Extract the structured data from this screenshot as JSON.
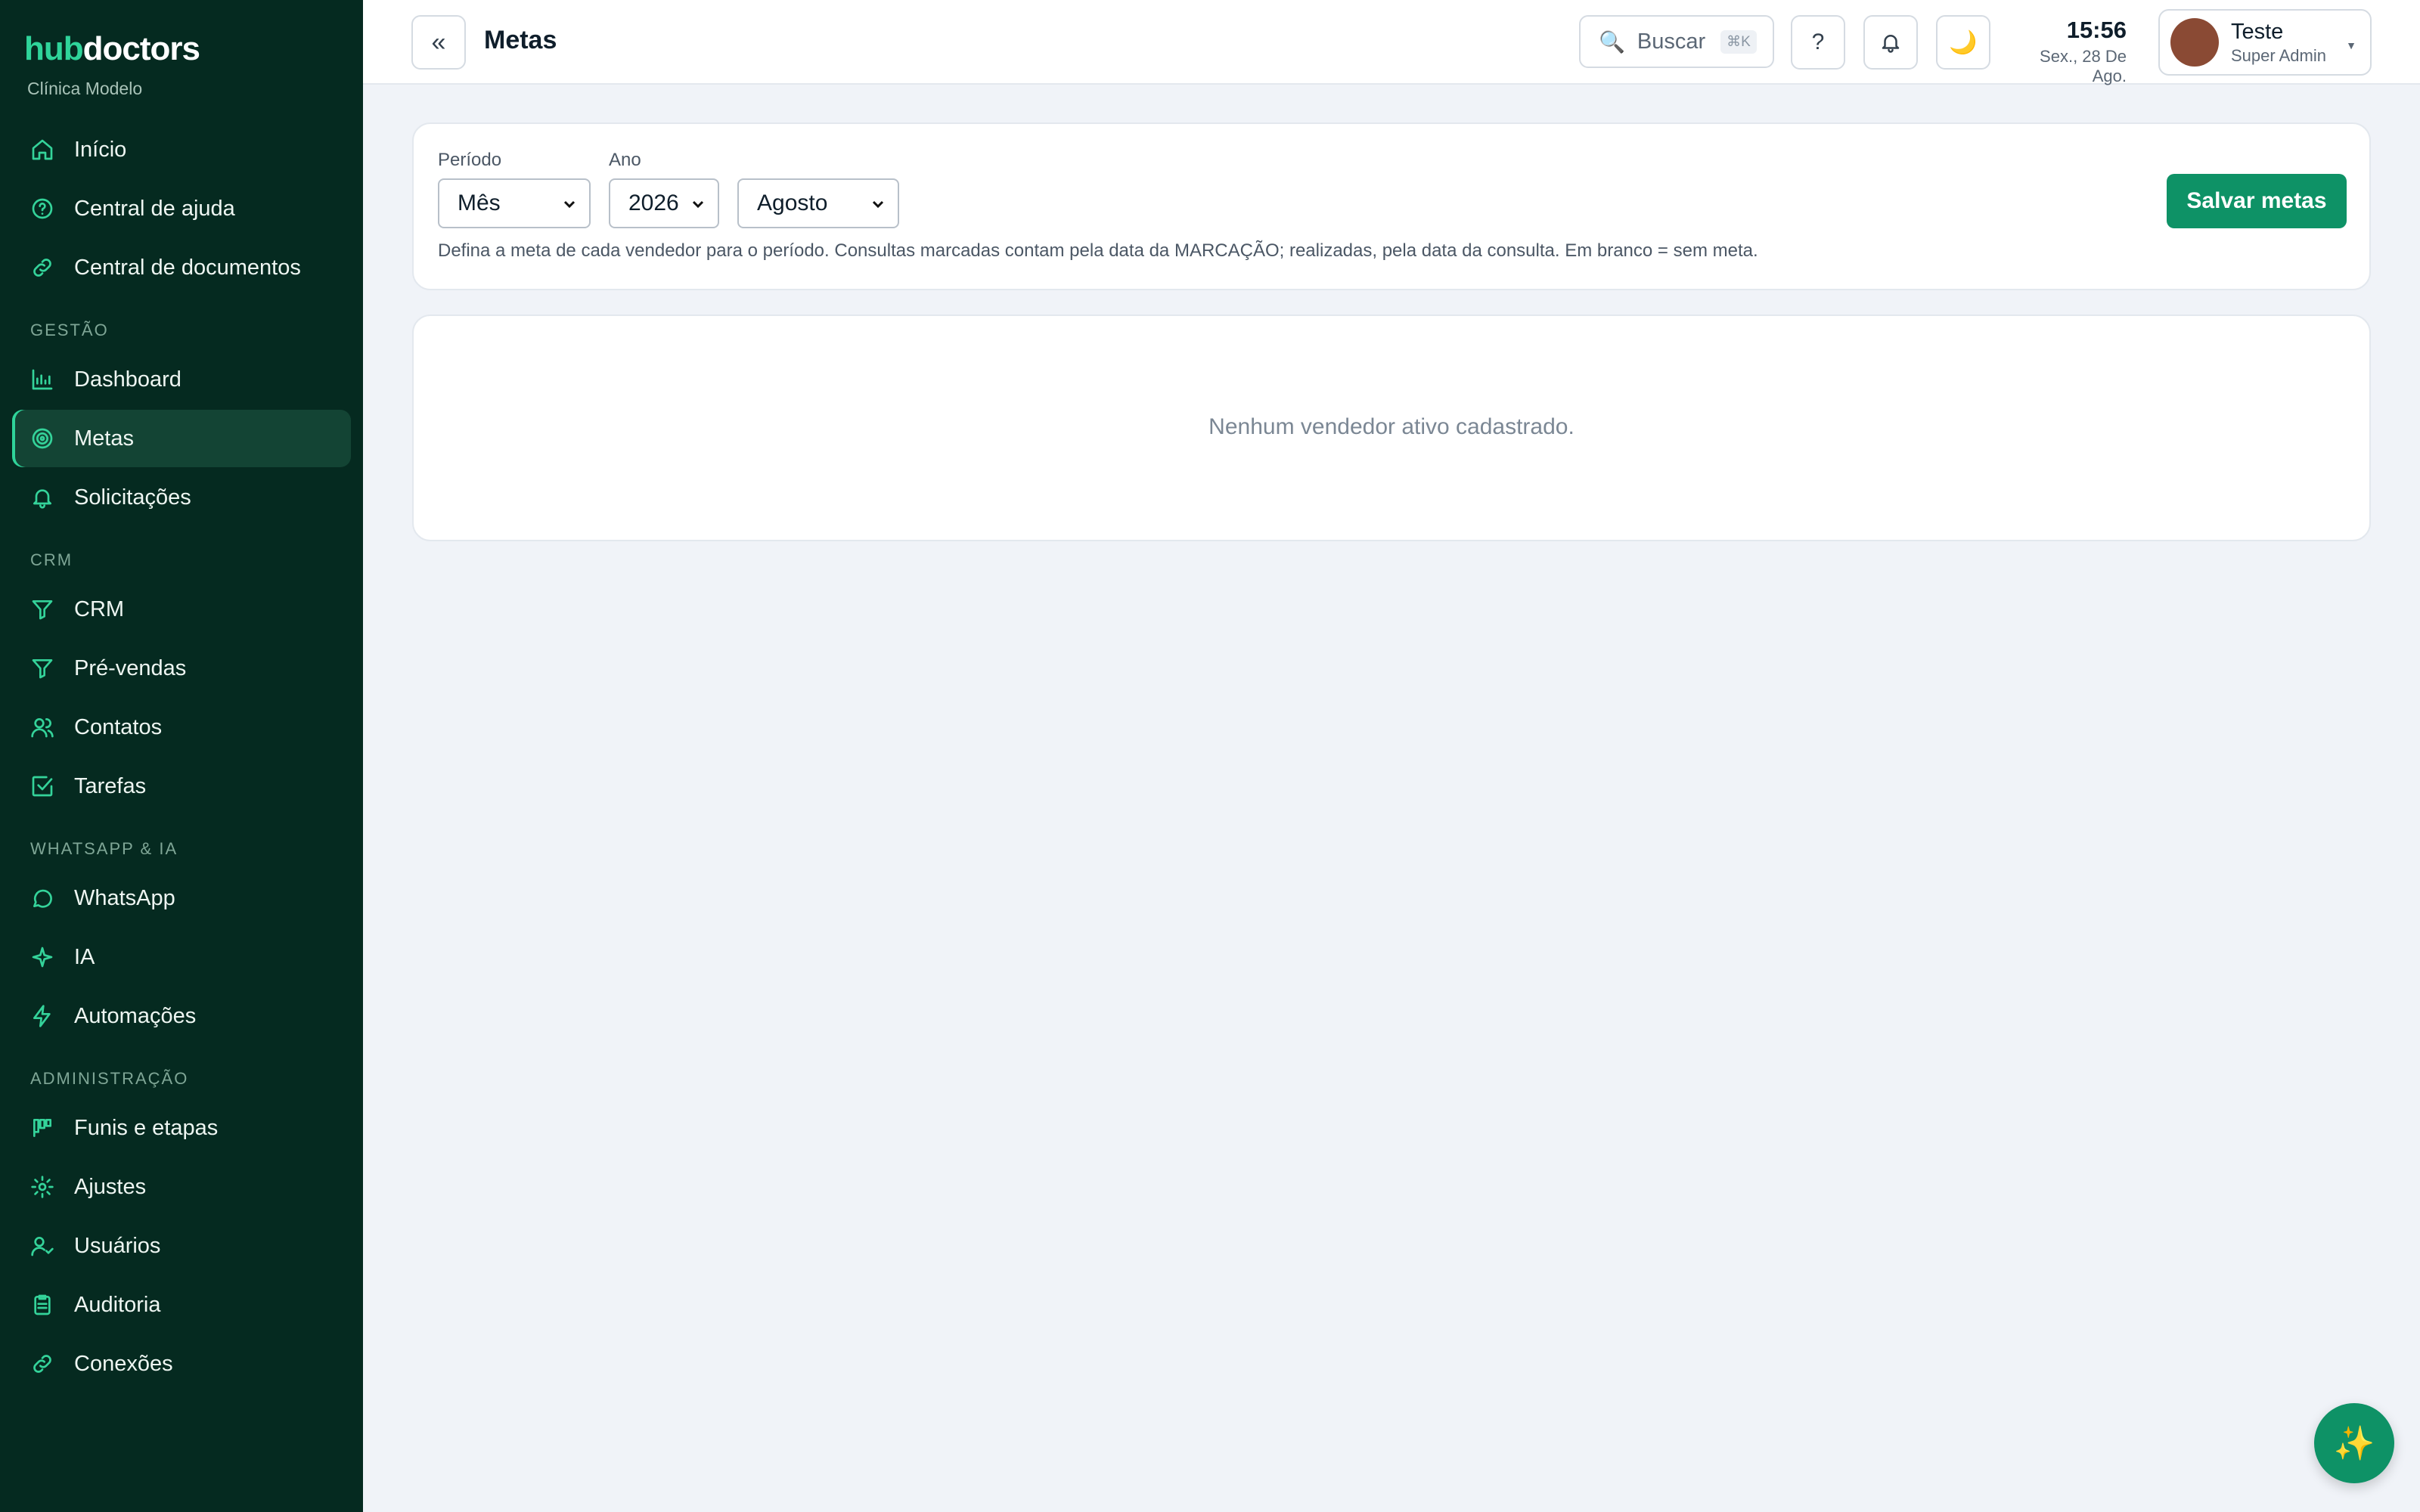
{
  "brand": {
    "part1": "hub",
    "part2": "doctors",
    "clinic": "Clínica Modelo"
  },
  "sidebar": {
    "items": [
      {
        "label": "Início",
        "icon": "home-icon"
      },
      {
        "label": "Central de ajuda",
        "icon": "help-circle-icon"
      },
      {
        "label": "Central de documentos",
        "icon": "link-icon"
      }
    ],
    "sections": [
      {
        "title": "GESTÃO",
        "items": [
          {
            "label": "Dashboard",
            "icon": "bar-chart-icon"
          },
          {
            "label": "Metas",
            "icon": "target-icon",
            "active": true
          },
          {
            "label": "Solicitações",
            "icon": "bell-icon"
          }
        ]
      },
      {
        "title": "CRM",
        "items": [
          {
            "label": "CRM",
            "icon": "funnel-icon"
          },
          {
            "label": "Pré-vendas",
            "icon": "funnel-icon"
          },
          {
            "label": "Contatos",
            "icon": "users-icon"
          },
          {
            "label": "Tarefas",
            "icon": "checkbox-icon"
          }
        ]
      },
      {
        "title": "WHATSAPP & IA",
        "items": [
          {
            "label": "WhatsApp",
            "icon": "chat-icon"
          },
          {
            "label": "IA",
            "icon": "sparkle-icon"
          },
          {
            "label": "Automações",
            "icon": "lightning-icon"
          }
        ]
      },
      {
        "title": "ADMINISTRAÇÃO",
        "items": [
          {
            "label": "Funis e etapas",
            "icon": "kanban-icon"
          },
          {
            "label": "Ajustes",
            "icon": "gear-icon"
          },
          {
            "label": "Usuários",
            "icon": "user-check-icon"
          },
          {
            "label": "Auditoria",
            "icon": "clipboard-icon"
          },
          {
            "label": "Conexões",
            "icon": "link-icon"
          }
        ]
      }
    ]
  },
  "header": {
    "collapse_glyph": "«",
    "title": "Metas",
    "search_label": "Buscar",
    "search_shortcut": "⌘K",
    "help_glyph": "?",
    "theme_glyph": "🌙",
    "time": "15:56",
    "date": "Sex., 28 De Ago.",
    "user_name": "Teste",
    "user_role": "Super Admin"
  },
  "filters": {
    "period_label": "Período",
    "period_value": "Mês",
    "year_label": "Ano",
    "year_value": "2026",
    "month_value": "Agosto",
    "hint": "Defina a meta de cada vendedor para o período. Consultas marcadas contam pela data da MARCAÇÃO; realizadas, pela data da consulta. Em branco = sem meta.",
    "save_label": "Salvar metas"
  },
  "empty_state": {
    "message": "Nenhum vendedor ativo cadastrado."
  },
  "colors": {
    "sidebar_bg": "#052a20",
    "accent": "#2fd49a",
    "primary_button": "#0e9266"
  }
}
